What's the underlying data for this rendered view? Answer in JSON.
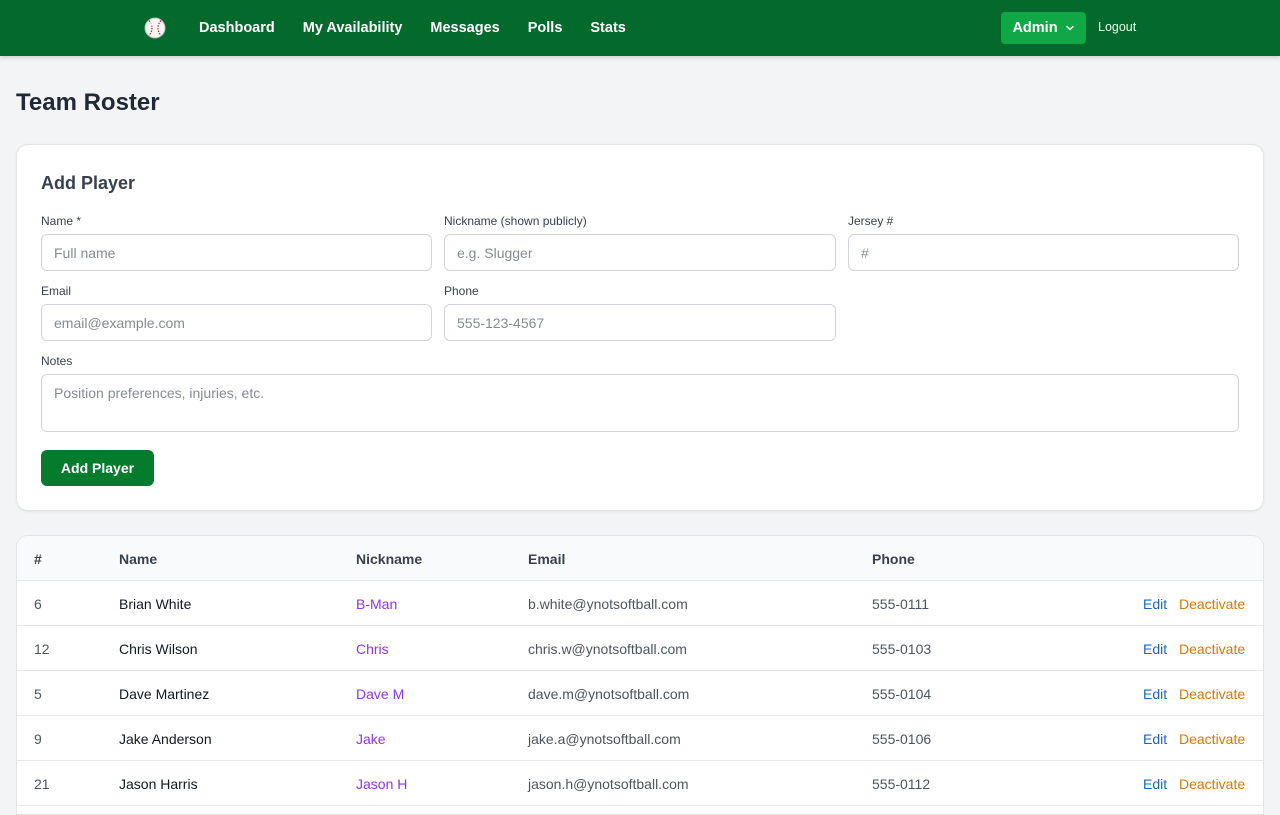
{
  "nav": {
    "links": [
      "Dashboard",
      "My Availability",
      "Messages",
      "Polls",
      "Stats"
    ],
    "admin_label": "Admin",
    "logout_label": "Logout"
  },
  "page_title": "Team Roster",
  "add_form": {
    "title": "Add Player",
    "name_label": "Name *",
    "name_placeholder": "Full name",
    "nickname_label": "Nickname (shown publicly)",
    "nickname_placeholder": "e.g. Slugger",
    "jersey_label": "Jersey #",
    "jersey_placeholder": "#",
    "email_label": "Email",
    "email_placeholder": "email@example.com",
    "phone_label": "Phone",
    "phone_placeholder": "555-123-4567",
    "notes_label": "Notes",
    "notes_placeholder": "Position preferences, injuries, etc.",
    "submit_label": "Add Player"
  },
  "table": {
    "headers": [
      "#",
      "Name",
      "Nickname",
      "Email",
      "Phone"
    ],
    "edit_label": "Edit",
    "deactivate_label": "Deactivate",
    "rows": [
      {
        "num": "6",
        "name": "Brian White",
        "nickname": "B-Man",
        "email": "b.white@ynotsoftball.com",
        "phone": "555-0111"
      },
      {
        "num": "12",
        "name": "Chris Wilson",
        "nickname": "Chris",
        "email": "chris.w@ynotsoftball.com",
        "phone": "555-0103"
      },
      {
        "num": "5",
        "name": "Dave Martinez",
        "nickname": "Dave M",
        "email": "dave.m@ynotsoftball.com",
        "phone": "555-0104"
      },
      {
        "num": "9",
        "name": "Jake Anderson",
        "nickname": "Jake",
        "email": "jake.a@ynotsoftball.com",
        "phone": "555-0106"
      },
      {
        "num": "21",
        "name": "Jason Harris",
        "nickname": "Jason H",
        "email": "jason.h@ynotsoftball.com",
        "phone": "555-0112"
      }
    ]
  },
  "colors": {
    "navbar": "#046a2c",
    "admin_button": "#10a845",
    "primary_button": "#047b2d",
    "nickname": "#9333ea",
    "edit_link": "#1d64c8",
    "deactivate_link": "#d97706"
  }
}
